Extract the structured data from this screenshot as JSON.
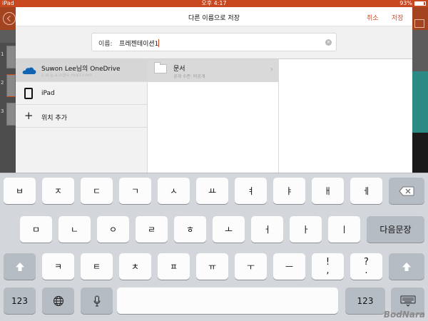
{
  "status_bar": {
    "carrier": "iPad",
    "time": "오후 4:17",
    "battery": "93%"
  },
  "dialog": {
    "title": "다른 이름으로 저장",
    "cancel_label": "취소",
    "save_label": "저장",
    "name_label": "이름:",
    "name_value": "프레젠테이션1"
  },
  "locations": [
    {
      "title": "Suwon Lee님의 OneDrive",
      "subtitle": "s.w.g.a.n@e.mail.com",
      "icon": "onedrive-icon",
      "selected": true
    },
    {
      "title": "iPad",
      "icon": "ipad-icon"
    },
    {
      "title": "위치 추가",
      "icon": "plus-icon"
    }
  ],
  "folders": [
    {
      "name": "문서",
      "sub": "공개 수준: 비공개"
    }
  ],
  "keyboard": {
    "row1": [
      "ㅂ",
      "ㅈ",
      "ㄷ",
      "ㄱ",
      "ㅅ",
      "ㅛ",
      "ㅕ",
      "ㅑ",
      "ㅐ",
      "ㅔ"
    ],
    "row2": [
      "ㅁ",
      "ㄴ",
      "ㅇ",
      "ㄹ",
      "ㅎ",
      "ㅗ",
      "ㅓ",
      "ㅏ",
      "ㅣ"
    ],
    "return_label": "다음문장",
    "row3": [
      "ㅋ",
      "ㅌ",
      "ㅊ",
      "ㅍ",
      "ㅠ",
      "ㅜ",
      "ㅡ"
    ],
    "punct_top": [
      "!",
      "?"
    ],
    "punct_bottom": [
      ",",
      "."
    ],
    "num_label": "123"
  },
  "watermark": "BodNara",
  "colors": {
    "accent": "#d24726",
    "app_bar": "#a4431f",
    "keyboard_bg": "#d3d6db"
  }
}
